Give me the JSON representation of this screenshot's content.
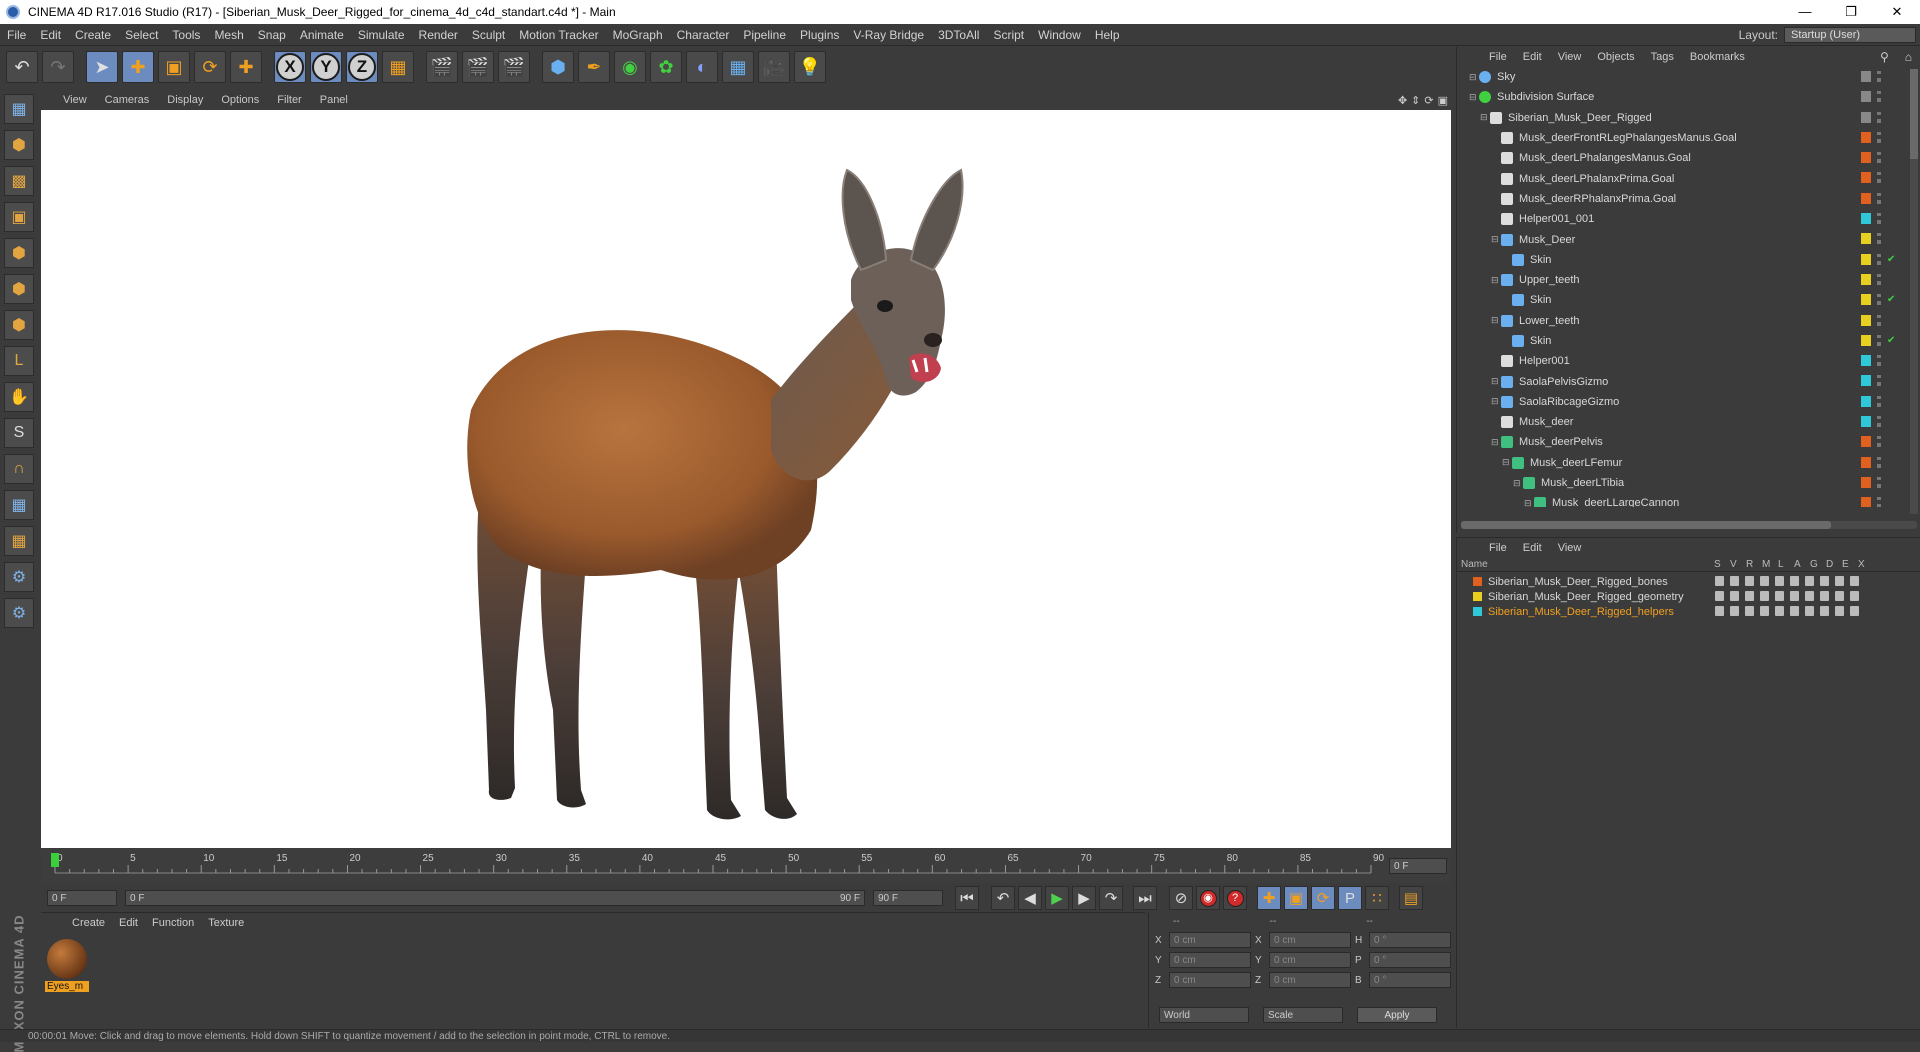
{
  "titlebar": {
    "title": "CINEMA 4D R17.016 Studio (R17) - [Siberian_Musk_Deer_Rigged_for_cinema_4d_c4d_standart.c4d *] - Main"
  },
  "menubar": {
    "items": [
      "File",
      "Edit",
      "Create",
      "Select",
      "Tools",
      "Mesh",
      "Snap",
      "Animate",
      "Simulate",
      "Render",
      "Sculpt",
      "Motion Tracker",
      "MoGraph",
      "Character",
      "Pipeline",
      "Plugins",
      "V-Ray Bridge",
      "3DToAll",
      "Script",
      "Window",
      "Help"
    ],
    "layout_label": "Layout:",
    "layout_value": "Startup (User)"
  },
  "toolbar": {
    "x": "X",
    "y": "Y",
    "z": "Z"
  },
  "viewport": {
    "menu": [
      "View",
      "Cameras",
      "Display",
      "Options",
      "Filter",
      "Panel"
    ]
  },
  "timeline": {
    "ticks": [
      "0",
      "5",
      "10",
      "15",
      "20",
      "25",
      "30",
      "35",
      "40",
      "45",
      "50",
      "55",
      "60",
      "65",
      "70",
      "75",
      "80",
      "85",
      "90"
    ],
    "end_field": "0 F"
  },
  "transport": {
    "start_field": "0 F",
    "slider_start": "0 F",
    "slider_end": "90 F",
    "end_field": "90 F"
  },
  "material_manager": {
    "menu": [
      "Create",
      "Edit",
      "Function",
      "Texture"
    ],
    "material_name": "Eyes_m",
    "brand": "MAXON CINEMA 4D"
  },
  "attributes": {
    "header_left": "--",
    "header_mid": "--",
    "header_right": "--",
    "rows": [
      {
        "l1": "X",
        "v1": "0 cm",
        "l2": "X",
        "v2": "0 cm",
        "l3": "H",
        "v3": "0 °"
      },
      {
        "l1": "Y",
        "v1": "0 cm",
        "l2": "Y",
        "v2": "0 cm",
        "l3": "P",
        "v3": "0 °"
      },
      {
        "l1": "Z",
        "v1": "0 cm",
        "l2": "Z",
        "v2": "0 cm",
        "l3": "B",
        "v3": "0 °"
      }
    ],
    "coord_mode": "World",
    "scale_mode": "Scale",
    "apply": "Apply"
  },
  "object_manager": {
    "menu": [
      "File",
      "Edit",
      "View",
      "Objects",
      "Tags",
      "Bookmarks"
    ],
    "objects": [
      {
        "name": "Sky",
        "indent": 0,
        "icon": "sky",
        "color": "#888888"
      },
      {
        "name": "Subdivision Surface",
        "indent": 0,
        "icon": "subdiv",
        "color": "#888888"
      },
      {
        "name": "Siberian_Musk_Deer_Rigged",
        "indent": 1,
        "icon": "null",
        "color": "#888888"
      },
      {
        "name": "Musk_deerFrontRLegPhalangesManus.Goal",
        "indent": 2,
        "icon": "null",
        "color": "#e06020"
      },
      {
        "name": "Musk_deerLPhalangesManus.Goal",
        "indent": 2,
        "icon": "null",
        "color": "#e06020"
      },
      {
        "name": "Musk_deerLPhalanxPrima.Goal",
        "indent": 2,
        "icon": "null",
        "color": "#e06020"
      },
      {
        "name": "Musk_deerRPhalanxPrima.Goal",
        "indent": 2,
        "icon": "null",
        "color": "#e06020"
      },
      {
        "name": "Helper001_001",
        "indent": 2,
        "icon": "null",
        "color": "#2fc8d8"
      },
      {
        "name": "Musk_Deer",
        "indent": 2,
        "icon": "poly",
        "color": "#e8d020"
      },
      {
        "name": "Skin",
        "indent": 3,
        "icon": "skin",
        "color": "#e8d020"
      },
      {
        "name": "Upper_teeth",
        "indent": 2,
        "icon": "poly",
        "color": "#e8d020"
      },
      {
        "name": "Skin",
        "indent": 3,
        "icon": "skin",
        "color": "#e8d020"
      },
      {
        "name": "Lower_teeth",
        "indent": 2,
        "icon": "poly",
        "color": "#e8d020"
      },
      {
        "name": "Skin",
        "indent": 3,
        "icon": "skin",
        "color": "#e8d020"
      },
      {
        "name": "Helper001",
        "indent": 2,
        "icon": "null",
        "color": "#2fc8d8"
      },
      {
        "name": "SaolaPelvisGizmo",
        "indent": 2,
        "icon": "poly",
        "color": "#2fc8d8"
      },
      {
        "name": "SaolaRibcageGizmo",
        "indent": 2,
        "icon": "poly",
        "color": "#2fc8d8"
      },
      {
        "name": "Musk_deer",
        "indent": 2,
        "icon": "null",
        "color": "#2fc8d8"
      },
      {
        "name": "Musk_deerPelvis",
        "indent": 2,
        "icon": "bone",
        "color": "#e06020"
      },
      {
        "name": "Musk_deerLFemur",
        "indent": 3,
        "icon": "bone",
        "color": "#e06020"
      },
      {
        "name": "Musk_deerLTibia",
        "indent": 4,
        "icon": "bone",
        "color": "#e06020"
      },
      {
        "name": "Musk_deerLLargeCannon",
        "indent": 5,
        "icon": "bone",
        "color": "#e06020"
      }
    ]
  },
  "layer_manager": {
    "menu": [
      "File",
      "Edit",
      "View"
    ],
    "header": {
      "name": "Name",
      "cols": [
        "S",
        "V",
        "R",
        "M",
        "L",
        "A",
        "G",
        "D",
        "E",
        "X"
      ]
    },
    "layers": [
      {
        "name": "Siberian_Musk_Deer_Rigged_bones",
        "color": "#e06020",
        "active": false
      },
      {
        "name": "Siberian_Musk_Deer_Rigged_geometry",
        "color": "#e8d020",
        "active": false
      },
      {
        "name": "Siberian_Musk_Deer_Rigged_helpers",
        "color": "#2fc8d8",
        "active": true
      }
    ]
  },
  "statusbar": {
    "text": "00:00:01   Move: Click and drag to move elements. Hold down SHIFT to quantize movement / add to the selection in point mode, CTRL to remove."
  },
  "colors": {
    "accent_orange": "#f0a020",
    "active_layer": "#f0a020",
    "play_green": "#4fd04f"
  }
}
